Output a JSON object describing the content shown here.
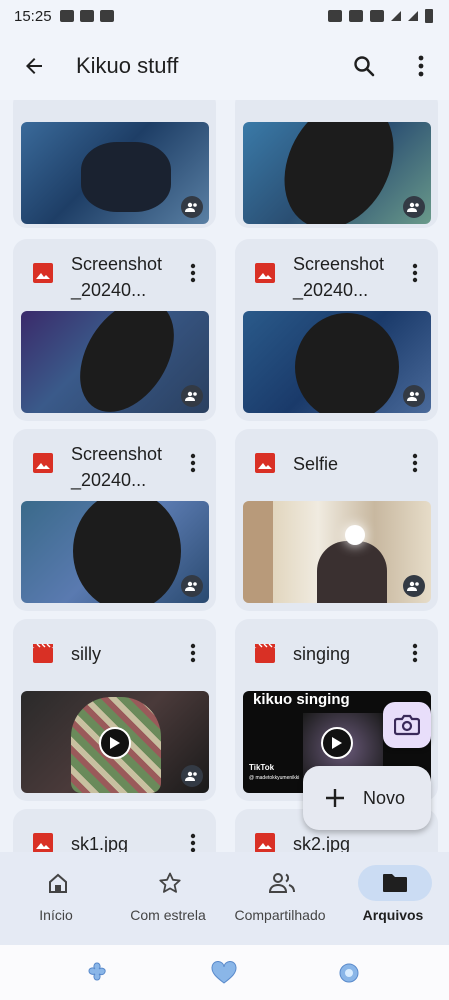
{
  "status_bar": {
    "time": "15:25"
  },
  "app_bar": {
    "title": "Kikuo stuff"
  },
  "files": [
    {
      "name": "",
      "kind": "image"
    },
    {
      "name": "",
      "kind": "image"
    },
    {
      "name": "Screenshot_20240...",
      "kind": "image"
    },
    {
      "name": "Screenshot_20240...",
      "kind": "image"
    },
    {
      "name": "Screenshot_20240...",
      "kind": "image"
    },
    {
      "name": "Selfie",
      "kind": "image"
    },
    {
      "name": "silly",
      "kind": "video"
    },
    {
      "name": "singing",
      "kind": "video",
      "thumb_caption": "kikuo singing",
      "thumb_brand": "TikTok",
      "thumb_handle": "@ madetokkyumenikki"
    },
    {
      "name": "sk1.jpg",
      "kind": "image"
    },
    {
      "name": "sk2.jpg",
      "kind": "image"
    }
  ],
  "fab": {
    "new_label": "Novo",
    "camera_icon": "camera-icon",
    "plus_icon": "plus-icon"
  },
  "bottom_nav": [
    {
      "label": "Início",
      "icon": "home-icon",
      "active": false
    },
    {
      "label": "Com estrela",
      "icon": "star-icon",
      "active": false
    },
    {
      "label": "Compartilhado",
      "icon": "people-icon",
      "active": false
    },
    {
      "label": "Arquivos",
      "icon": "folder-icon",
      "active": true
    }
  ],
  "colors": {
    "image_icon": "#d93025",
    "video_icon": "#d93025",
    "active_pill": "#cbdcf3",
    "camera_fab": "#e8defa"
  }
}
